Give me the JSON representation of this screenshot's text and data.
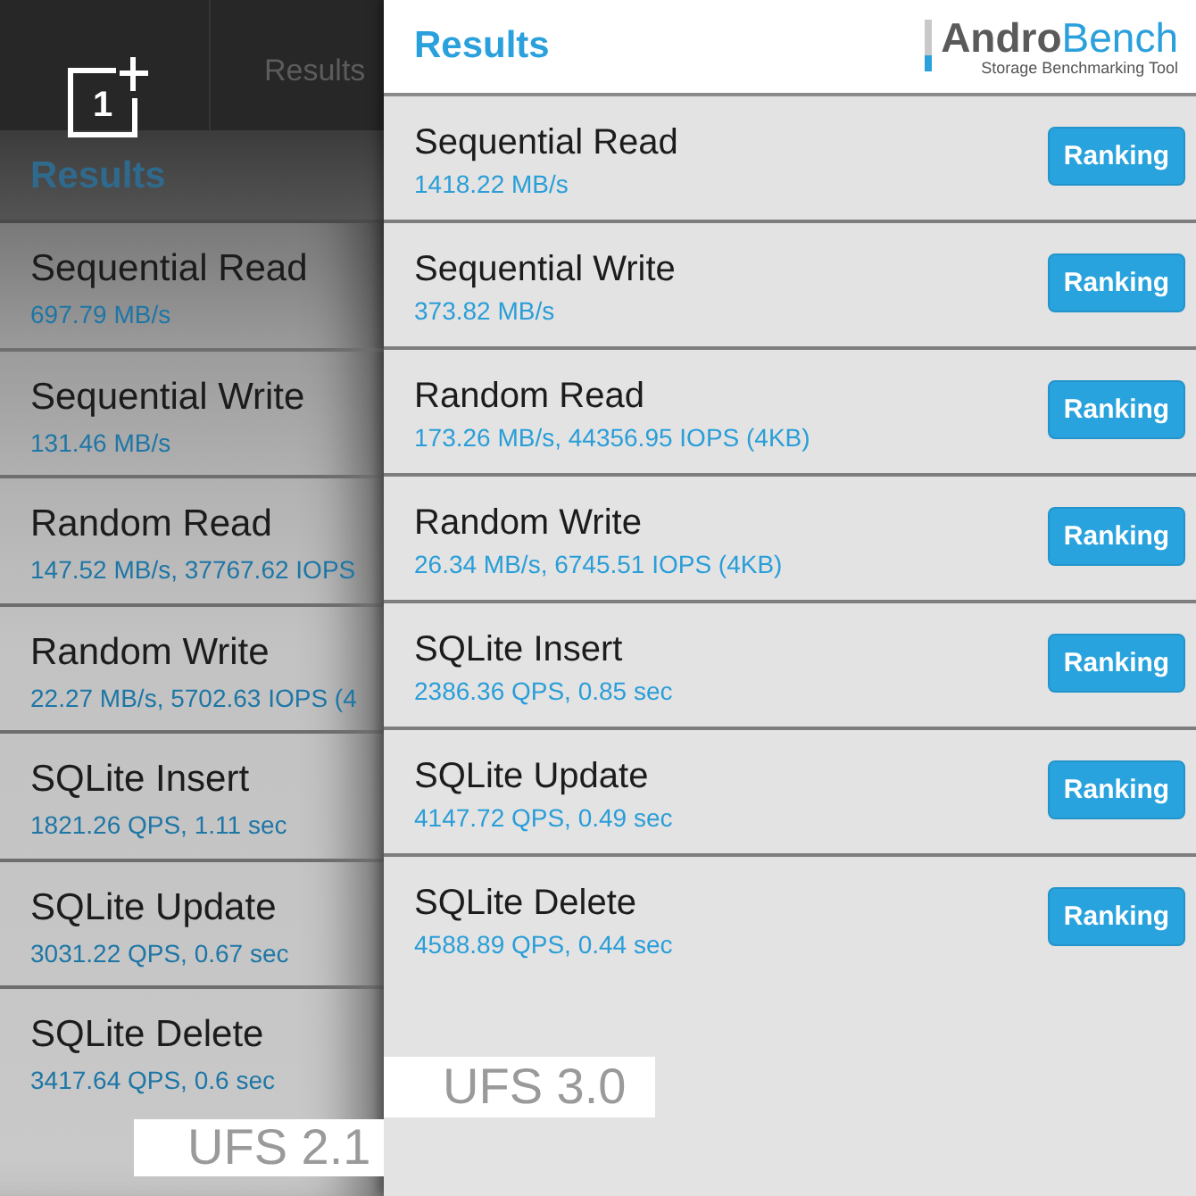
{
  "back_screen": {
    "logo": {
      "text": "1"
    },
    "tabs": [
      {
        "label": "Results"
      }
    ],
    "section_title": "Results",
    "results": [
      {
        "name": "Sequential Read",
        "value": "697.79 MB/s"
      },
      {
        "name": "Sequential Write",
        "value": "131.46 MB/s"
      },
      {
        "name": "Random Read",
        "value": "147.52 MB/s, 37767.62 IOPS"
      },
      {
        "name": "Random Write",
        "value": "22.27 MB/s, 5702.63 IOPS (4"
      },
      {
        "name": "SQLite Insert",
        "value": "1821.26 QPS, 1.11 sec"
      },
      {
        "name": "SQLite Update",
        "value": "3031.22 QPS, 0.67 sec"
      },
      {
        "name": "SQLite Delete",
        "value": "3417.64 QPS, 0.6 sec"
      }
    ],
    "caption": "UFS 2.1"
  },
  "front_screen": {
    "title": "Results",
    "logo": {
      "wordmark": "**Andro**Bench",
      "tagline": "Storage Benchmarking Tool"
    },
    "results": [
      {
        "name": "Sequential Read",
        "value": "1418.22 MB/s",
        "button": "Ranking"
      },
      {
        "name": "Sequential Write",
        "value": "373.82 MB/s",
        "button": "Ranking"
      },
      {
        "name": "Random Read",
        "value": "173.26 MB/s, 44356.95 IOPS (4KB)",
        "button": "Ranking"
      },
      {
        "name": "Random Write",
        "value": "26.34 MB/s, 6745.51 IOPS (4KB)",
        "button": "Ranking"
      },
      {
        "name": "SQLite Insert",
        "value": "2386.36 QPS, 0.85 sec",
        "button": "Ranking"
      },
      {
        "name": "SQLite Update",
        "value": "4147.72 QPS, 0.49 sec",
        "button": "Ranking"
      },
      {
        "name": "SQLite Delete",
        "value": "4588.89 QPS, 0.44 sec",
        "button": "Ranking"
      }
    ],
    "caption": "UFS 3.0"
  }
}
